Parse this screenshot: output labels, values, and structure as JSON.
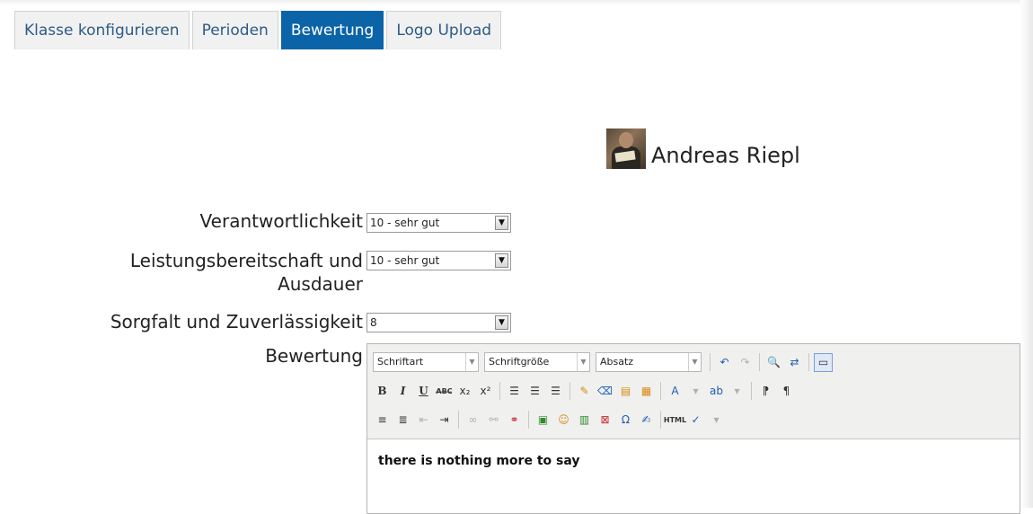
{
  "tabs": [
    {
      "label": "Klasse konfigurieren",
      "active": false
    },
    {
      "label": "Perioden",
      "active": false
    },
    {
      "label": "Bewertung",
      "active": true
    },
    {
      "label": "Logo Upload",
      "active": false
    }
  ],
  "student": {
    "name": "Andreas Riepl"
  },
  "form": {
    "verantwortlichkeit": {
      "label": "Verantwortlichkeit",
      "value": "10 - sehr gut"
    },
    "leistungsbereitschaft": {
      "label_line1": "Leistungsbereitschaft und",
      "label_line2": "Ausdauer",
      "value": "10 - sehr gut"
    },
    "sorgfalt": {
      "label": "Sorgfalt und Zuverlässigkeit",
      "value": "8"
    },
    "bewertung": {
      "label": "Bewertung"
    }
  },
  "editor": {
    "font_family_combo": "Schriftart",
    "font_size_combo": "Schriftgröße",
    "format_combo": "Absatz",
    "content": "there is nothing more to say"
  },
  "colors": {
    "active_tab": "#0b64a8",
    "tab_text": "#2d5b86"
  }
}
